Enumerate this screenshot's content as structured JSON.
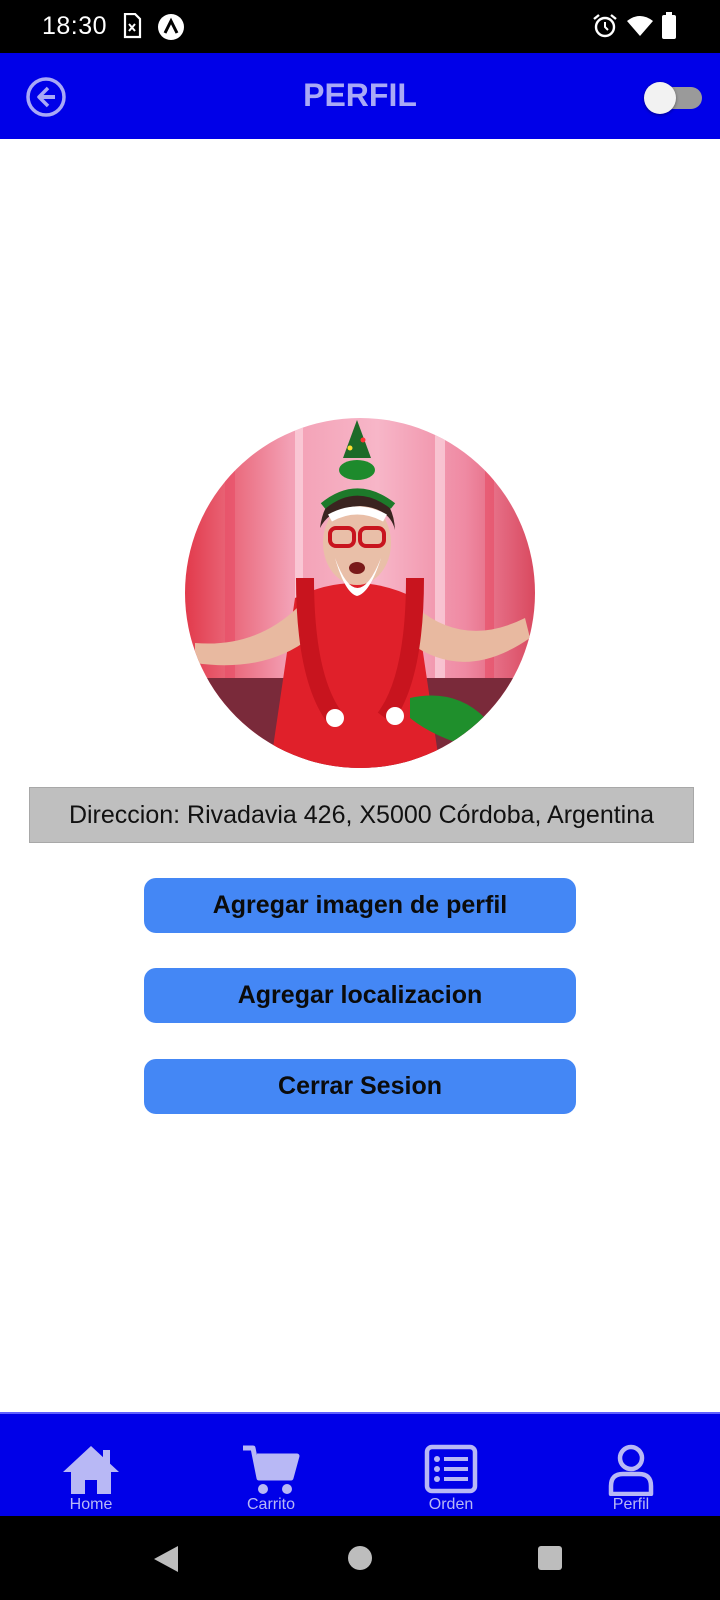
{
  "status_bar": {
    "time": "18:30",
    "icons": [
      "sim-card-icon",
      "app-a-icon",
      "alarm-icon",
      "wifi-icon",
      "battery-icon"
    ]
  },
  "header": {
    "title": "PERFIL",
    "back_icon": "arrow-left-circle-icon",
    "theme_toggle": "off"
  },
  "profile": {
    "avatar_alt": "profile-photo",
    "address": "Direccion: Rivadavia 426, X5000 Córdoba, Argentina"
  },
  "actions": {
    "add_image_label": "Agregar imagen de perfil",
    "add_location_label": "Agregar localizacion",
    "logout_label": "Cerrar Sesion"
  },
  "bottom_nav": {
    "items": [
      {
        "label": "Home",
        "icon": "home-icon"
      },
      {
        "label": "Carrito",
        "icon": "cart-icon"
      },
      {
        "label": "Orden",
        "icon": "list-icon"
      },
      {
        "label": "Perfil",
        "icon": "user-icon"
      }
    ]
  },
  "colors": {
    "primary": "#0000e8",
    "button": "#4487f5",
    "title_text": "#a9a9f6",
    "address_bg": "#bfbfbf"
  }
}
